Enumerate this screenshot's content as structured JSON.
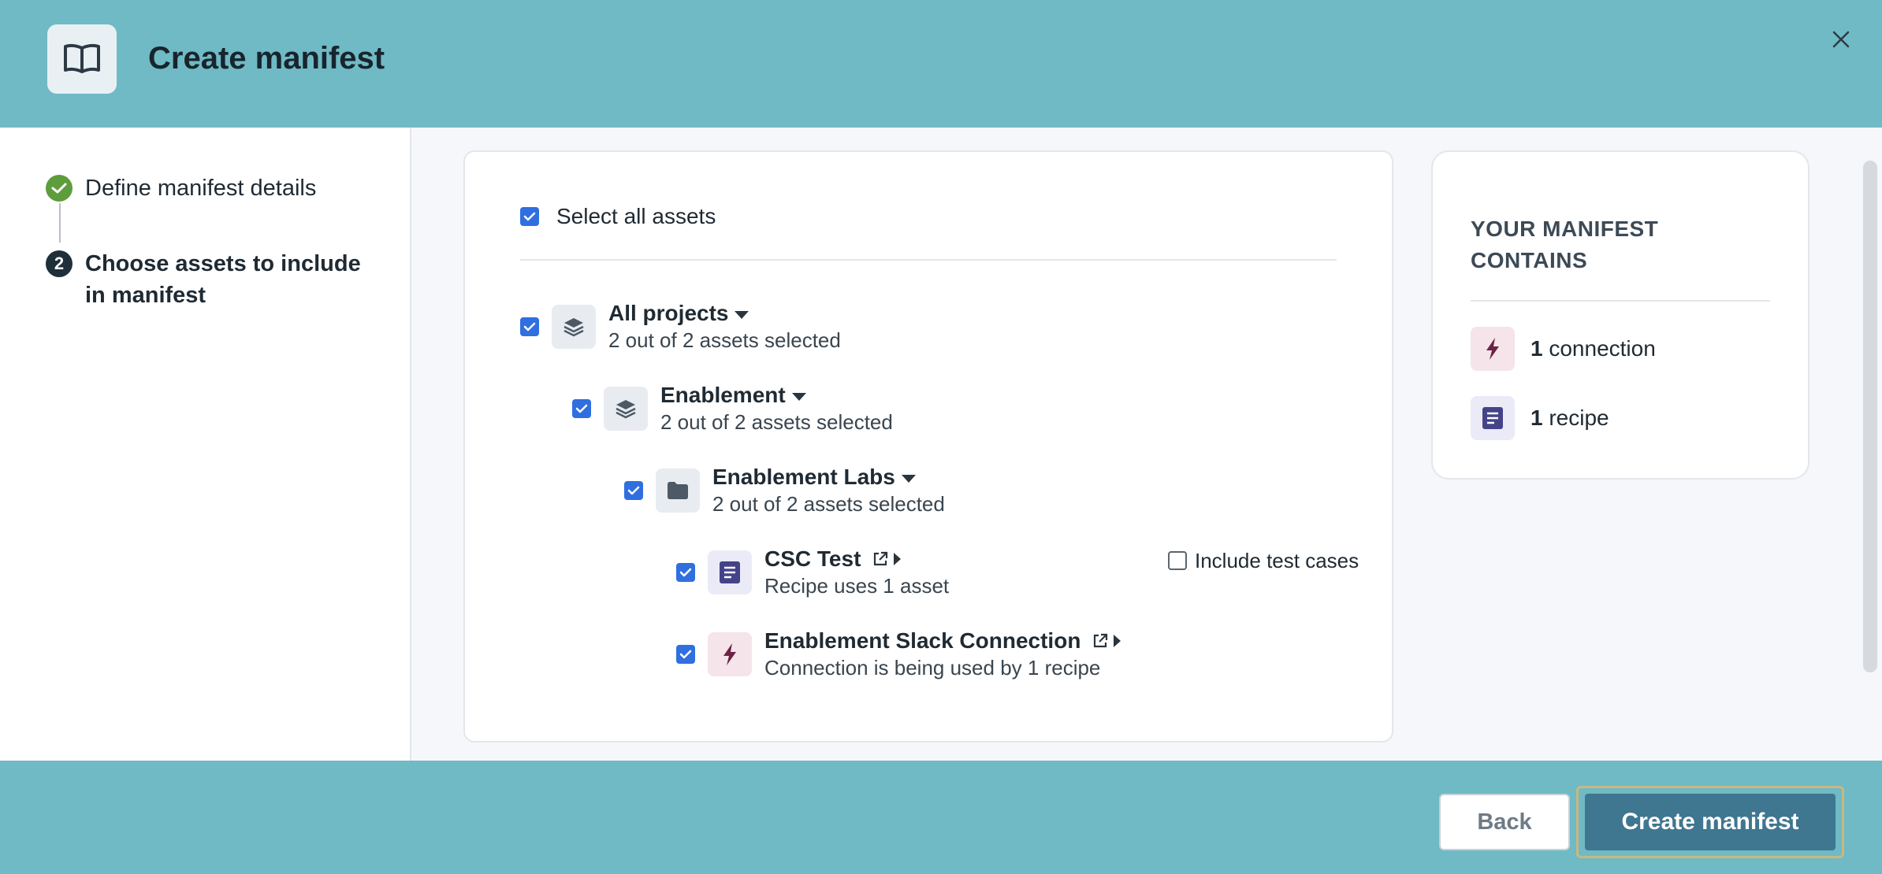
{
  "header": {
    "title": "Create manifest",
    "icon": "book-icon",
    "close_icon": "close-icon"
  },
  "stepper": {
    "steps": [
      {
        "label": "Define manifest details",
        "status": "complete"
      },
      {
        "number": "2",
        "label": "Choose assets to include in manifest",
        "status": "active"
      }
    ]
  },
  "assets": {
    "select_all_label": "Select all assets",
    "tree": [
      {
        "title": "All projects",
        "subtitle": "2 out of 2 assets selected",
        "icon": "layers-icon",
        "checked": true
      },
      {
        "title": "Enablement",
        "subtitle": "2 out of 2 assets selected",
        "icon": "layers-icon",
        "checked": true
      },
      {
        "title": "Enablement Labs",
        "subtitle": "2 out of 2 assets selected",
        "icon": "folder-icon",
        "checked": true
      },
      {
        "title": "CSC Test",
        "subtitle": "Recipe uses 1 asset",
        "icon": "recipe-icon",
        "checked": true,
        "option_label": "Include test cases",
        "option_checked": false
      },
      {
        "title": "Enablement Slack Connection",
        "subtitle": "Connection is being used by 1 recipe",
        "icon": "lightning-icon",
        "checked": true
      }
    ]
  },
  "summary": {
    "heading": "YOUR MANIFEST CONTAINS",
    "items": [
      {
        "count": "1",
        "label": "connection",
        "icon": "lightning-icon"
      },
      {
        "count": "1",
        "label": "recipe",
        "icon": "recipe-icon"
      }
    ]
  },
  "footer": {
    "back_label": "Back",
    "create_label": "Create manifest"
  },
  "colors": {
    "teal": "#6fbac4",
    "checkbox": "#2f6fe0",
    "primary_button": "#3f7690",
    "success": "#5e9d3c"
  }
}
